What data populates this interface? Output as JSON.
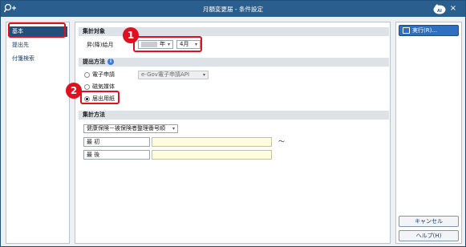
{
  "window": {
    "title": "月額変更届 - 条件設定",
    "icon": "search-plus-icon",
    "close": "×",
    "logo": "ai-logo-icon"
  },
  "nav": {
    "items": [
      {
        "label": "基本"
      },
      {
        "label": "提出先"
      },
      {
        "label": "付箋検索"
      }
    ]
  },
  "aggregation_target": {
    "heading": "集計対象",
    "label": "昇(降)給月",
    "year_suffix": "年",
    "month_value": "4月"
  },
  "submission_method": {
    "heading": "提出方法",
    "options": [
      {
        "label": "電子申請",
        "selected": false
      },
      {
        "label": "磁気媒体",
        "selected": false
      },
      {
        "label": "届出用紙",
        "selected": true
      }
    ],
    "electronic_select": "e-Gov電子申請API"
  },
  "aggregation_method": {
    "heading": "集計方法",
    "order_select": "健康保険－被保険者整理番号順",
    "first_label": "最 初",
    "last_label": "最 後",
    "range_separator": "～"
  },
  "markers": [
    "1",
    "2"
  ],
  "side": {
    "execute_label": "実行(R)...",
    "cancel_label": "キャンセル",
    "help_label": "ヘルプ(H)"
  },
  "colors": {
    "title_bar": "#2a5e8e",
    "highlight": "#e0101e",
    "active_nav": "#1f4f7a",
    "input_fill": "#fffde0"
  }
}
